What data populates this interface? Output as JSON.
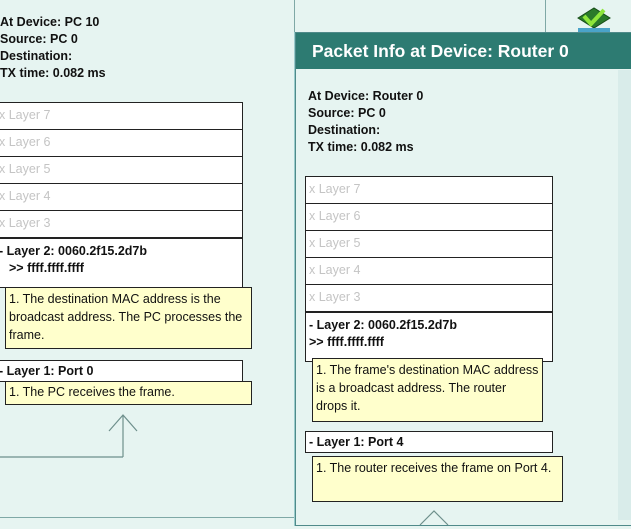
{
  "left_panel": {
    "info": {
      "at_device": "At Device: PC 10",
      "source": "Source: PC 0",
      "destination": "Destination:",
      "tx_time": "TX time: 0.082 ms"
    },
    "layers": [
      "x Layer 7",
      "x Layer 6",
      "x Layer 5",
      "x Layer 4",
      "x Layer 3"
    ],
    "layer2_line1": "- Layer 2: 0060.2f15.2d7b",
    "layer2_line2": ">> ffff.ffff.ffff",
    "layer2_note": "1. The destination MAC address is the broadcast address. The PC processes the frame.",
    "layer1": "- Layer 1: Port 0",
    "layer1_note": "1. The PC receives the frame."
  },
  "right_panel": {
    "title": "Packet Info at Device: Router 0",
    "info": {
      "at_device": "At Device: Router 0",
      "source": "Source: PC 0",
      "destination": "Destination:",
      "tx_time": "TX time: 0.082 ms"
    },
    "layers": [
      "x Layer 7",
      "x Layer 6",
      "x Layer 5",
      "x Layer 4",
      "x Layer 3"
    ],
    "layer2_line1": "- Layer 2: 0060.2f15.2d7b",
    "layer2_line2": ">> ffff.ffff.ffff",
    "layer2_note": "1. The frame's destination MAC address is a broadcast address. The router drops it.",
    "layer1": "- Layer 1: Port 4",
    "layer1_note": "1. The router receives the frame on Port 4."
  },
  "icons": {
    "top_right": "green-check-envelope-icon",
    "upward_arrow": "up-arrow-icon"
  },
  "colors": {
    "title_bar": "#2d7b72",
    "background": "#e6f4f1",
    "note_background": "#ffffcc"
  }
}
